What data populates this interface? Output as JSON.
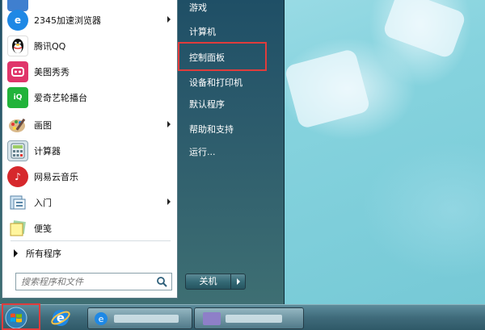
{
  "start_menu": {
    "programs": [
      {
        "label": "",
        "icon": "app-icon",
        "color": "#3f7fcf"
      },
      {
        "label": "2345加速浏览器",
        "icon": "browser-icon",
        "color": "#1e88e5",
        "glyph": "e",
        "submenu": true
      },
      {
        "label": "腾讯QQ",
        "icon": "qq-penguin-icon",
        "color": "#222222",
        "glyph": "Q"
      },
      {
        "label": "美图秀秀",
        "icon": "meitu-icon",
        "color": "#e0356a",
        "glyph": "M"
      },
      {
        "label": "爱奇艺轮播台",
        "icon": "iqiyi-icon",
        "color": "#21b33a",
        "glyph": "iQ"
      },
      {
        "label": "画图",
        "icon": "paint-palette-icon",
        "color": "#3a8fd0",
        "glyph": "✎",
        "submenu": true
      },
      {
        "label": "计算器",
        "icon": "calculator-icon",
        "color": "#5f7f95",
        "glyph": "#"
      },
      {
        "label": "网易云音乐",
        "icon": "netease-music-icon",
        "color": "#d6282c",
        "glyph": "♪"
      },
      {
        "label": "入门",
        "icon": "getting-started-icon",
        "color": "#6c8fb0",
        "glyph": "i",
        "submenu": true
      },
      {
        "label": "便笺",
        "icon": "sticky-notes-icon",
        "color": "#e3c85a",
        "glyph": "✎"
      }
    ],
    "all_programs": "所有程序",
    "search_placeholder": "搜索程序和文件",
    "right_items": [
      "游戏",
      "计算机",
      "控制面板",
      "设备和打印机",
      "默认程序",
      "帮助和支持",
      "运行..."
    ],
    "shutdown_label": "关机"
  },
  "accent_highlight": "#e03c3c"
}
